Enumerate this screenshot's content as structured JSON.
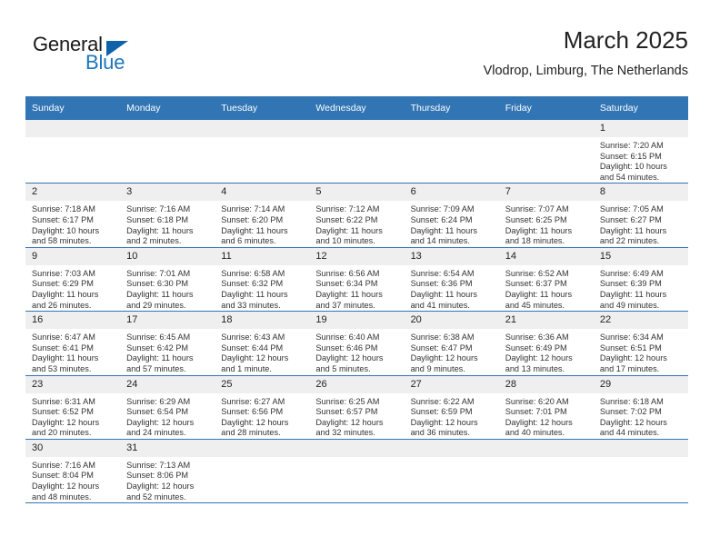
{
  "brand": {
    "name_part1": "General",
    "name_part2": "Blue",
    "accent_color": "#1b75bb",
    "triangle_color": "#0f62a8"
  },
  "header": {
    "title": "March 2025",
    "subtitle": "Vlodrop, Limburg, The Netherlands"
  },
  "theme": {
    "header_bar_color": "#3175b4",
    "daynum_band_color": "#efefef",
    "row_divider_color": "#3175b4"
  },
  "weekdays": [
    "Sunday",
    "Monday",
    "Tuesday",
    "Wednesday",
    "Thursday",
    "Friday",
    "Saturday"
  ],
  "weeks": [
    [
      {
        "day": "",
        "lines": []
      },
      {
        "day": "",
        "lines": []
      },
      {
        "day": "",
        "lines": []
      },
      {
        "day": "",
        "lines": []
      },
      {
        "day": "",
        "lines": []
      },
      {
        "day": "",
        "lines": []
      },
      {
        "day": "1",
        "lines": [
          "Sunrise: 7:20 AM",
          "Sunset: 6:15 PM",
          "Daylight: 10 hours",
          "and 54 minutes."
        ]
      }
    ],
    [
      {
        "day": "2",
        "lines": [
          "Sunrise: 7:18 AM",
          "Sunset: 6:17 PM",
          "Daylight: 10 hours",
          "and 58 minutes."
        ]
      },
      {
        "day": "3",
        "lines": [
          "Sunrise: 7:16 AM",
          "Sunset: 6:18 PM",
          "Daylight: 11 hours",
          "and 2 minutes."
        ]
      },
      {
        "day": "4",
        "lines": [
          "Sunrise: 7:14 AM",
          "Sunset: 6:20 PM",
          "Daylight: 11 hours",
          "and 6 minutes."
        ]
      },
      {
        "day": "5",
        "lines": [
          "Sunrise: 7:12 AM",
          "Sunset: 6:22 PM",
          "Daylight: 11 hours",
          "and 10 minutes."
        ]
      },
      {
        "day": "6",
        "lines": [
          "Sunrise: 7:09 AM",
          "Sunset: 6:24 PM",
          "Daylight: 11 hours",
          "and 14 minutes."
        ]
      },
      {
        "day": "7",
        "lines": [
          "Sunrise: 7:07 AM",
          "Sunset: 6:25 PM",
          "Daylight: 11 hours",
          "and 18 minutes."
        ]
      },
      {
        "day": "8",
        "lines": [
          "Sunrise: 7:05 AM",
          "Sunset: 6:27 PM",
          "Daylight: 11 hours",
          "and 22 minutes."
        ]
      }
    ],
    [
      {
        "day": "9",
        "lines": [
          "Sunrise: 7:03 AM",
          "Sunset: 6:29 PM",
          "Daylight: 11 hours",
          "and 26 minutes."
        ]
      },
      {
        "day": "10",
        "lines": [
          "Sunrise: 7:01 AM",
          "Sunset: 6:30 PM",
          "Daylight: 11 hours",
          "and 29 minutes."
        ]
      },
      {
        "day": "11",
        "lines": [
          "Sunrise: 6:58 AM",
          "Sunset: 6:32 PM",
          "Daylight: 11 hours",
          "and 33 minutes."
        ]
      },
      {
        "day": "12",
        "lines": [
          "Sunrise: 6:56 AM",
          "Sunset: 6:34 PM",
          "Daylight: 11 hours",
          "and 37 minutes."
        ]
      },
      {
        "day": "13",
        "lines": [
          "Sunrise: 6:54 AM",
          "Sunset: 6:36 PM",
          "Daylight: 11 hours",
          "and 41 minutes."
        ]
      },
      {
        "day": "14",
        "lines": [
          "Sunrise: 6:52 AM",
          "Sunset: 6:37 PM",
          "Daylight: 11 hours",
          "and 45 minutes."
        ]
      },
      {
        "day": "15",
        "lines": [
          "Sunrise: 6:49 AM",
          "Sunset: 6:39 PM",
          "Daylight: 11 hours",
          "and 49 minutes."
        ]
      }
    ],
    [
      {
        "day": "16",
        "lines": [
          "Sunrise: 6:47 AM",
          "Sunset: 6:41 PM",
          "Daylight: 11 hours",
          "and 53 minutes."
        ]
      },
      {
        "day": "17",
        "lines": [
          "Sunrise: 6:45 AM",
          "Sunset: 6:42 PM",
          "Daylight: 11 hours",
          "and 57 minutes."
        ]
      },
      {
        "day": "18",
        "lines": [
          "Sunrise: 6:43 AM",
          "Sunset: 6:44 PM",
          "Daylight: 12 hours",
          "and 1 minute."
        ]
      },
      {
        "day": "19",
        "lines": [
          "Sunrise: 6:40 AM",
          "Sunset: 6:46 PM",
          "Daylight: 12 hours",
          "and 5 minutes."
        ]
      },
      {
        "day": "20",
        "lines": [
          "Sunrise: 6:38 AM",
          "Sunset: 6:47 PM",
          "Daylight: 12 hours",
          "and 9 minutes."
        ]
      },
      {
        "day": "21",
        "lines": [
          "Sunrise: 6:36 AM",
          "Sunset: 6:49 PM",
          "Daylight: 12 hours",
          "and 13 minutes."
        ]
      },
      {
        "day": "22",
        "lines": [
          "Sunrise: 6:34 AM",
          "Sunset: 6:51 PM",
          "Daylight: 12 hours",
          "and 17 minutes."
        ]
      }
    ],
    [
      {
        "day": "23",
        "lines": [
          "Sunrise: 6:31 AM",
          "Sunset: 6:52 PM",
          "Daylight: 12 hours",
          "and 20 minutes."
        ]
      },
      {
        "day": "24",
        "lines": [
          "Sunrise: 6:29 AM",
          "Sunset: 6:54 PM",
          "Daylight: 12 hours",
          "and 24 minutes."
        ]
      },
      {
        "day": "25",
        "lines": [
          "Sunrise: 6:27 AM",
          "Sunset: 6:56 PM",
          "Daylight: 12 hours",
          "and 28 minutes."
        ]
      },
      {
        "day": "26",
        "lines": [
          "Sunrise: 6:25 AM",
          "Sunset: 6:57 PM",
          "Daylight: 12 hours",
          "and 32 minutes."
        ]
      },
      {
        "day": "27",
        "lines": [
          "Sunrise: 6:22 AM",
          "Sunset: 6:59 PM",
          "Daylight: 12 hours",
          "and 36 minutes."
        ]
      },
      {
        "day": "28",
        "lines": [
          "Sunrise: 6:20 AM",
          "Sunset: 7:01 PM",
          "Daylight: 12 hours",
          "and 40 minutes."
        ]
      },
      {
        "day": "29",
        "lines": [
          "Sunrise: 6:18 AM",
          "Sunset: 7:02 PM",
          "Daylight: 12 hours",
          "and 44 minutes."
        ]
      }
    ],
    [
      {
        "day": "30",
        "lines": [
          "Sunrise: 7:16 AM",
          "Sunset: 8:04 PM",
          "Daylight: 12 hours",
          "and 48 minutes."
        ]
      },
      {
        "day": "31",
        "lines": [
          "Sunrise: 7:13 AM",
          "Sunset: 8:06 PM",
          "Daylight: 12 hours",
          "and 52 minutes."
        ]
      },
      {
        "day": "",
        "lines": []
      },
      {
        "day": "",
        "lines": []
      },
      {
        "day": "",
        "lines": []
      },
      {
        "day": "",
        "lines": []
      },
      {
        "day": "",
        "lines": []
      }
    ]
  ]
}
